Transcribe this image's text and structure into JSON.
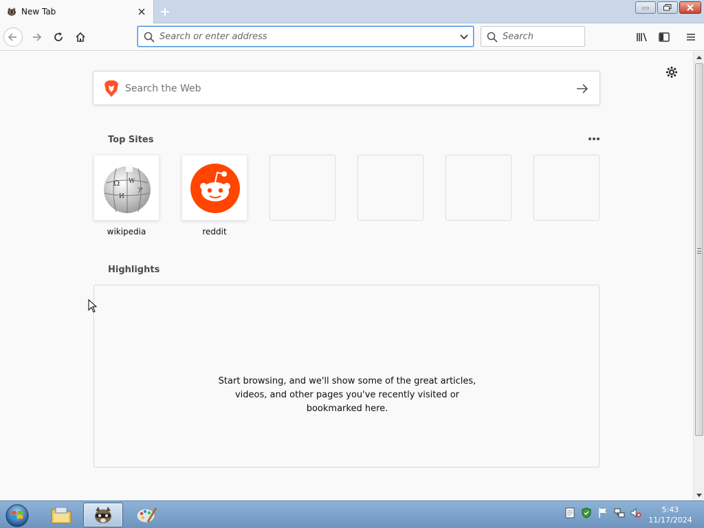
{
  "browser": {
    "tab": {
      "title": "New Tab"
    },
    "urlbar": {
      "placeholder": "Search or enter address"
    },
    "searchbar": {
      "placeholder": "Search"
    },
    "accent_color": "#0a84ff"
  },
  "newtab": {
    "web_search": {
      "placeholder": "Search the Web"
    },
    "top_sites": {
      "title": "Top Sites",
      "items": [
        {
          "label": "wikipedia",
          "icon": "wikipedia-globe-icon"
        },
        {
          "label": "reddit",
          "icon": "reddit-snoo-icon"
        },
        {
          "label": "",
          "icon": ""
        },
        {
          "label": "",
          "icon": ""
        },
        {
          "label": "",
          "icon": ""
        },
        {
          "label": "",
          "icon": ""
        }
      ]
    },
    "highlights": {
      "title": "Highlights",
      "empty_message": "Start browsing, and we'll show some of the great articles, videos, and other pages you've recently visited or bookmarked here."
    }
  },
  "taskbar": {
    "clock": {
      "time": "5:43",
      "date": "11/17/2024"
    }
  }
}
